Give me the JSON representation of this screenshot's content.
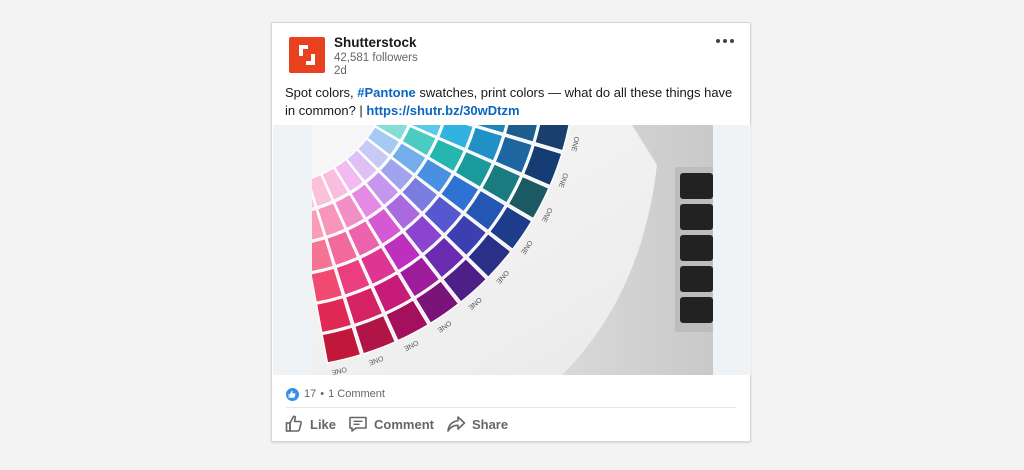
{
  "post": {
    "company_name": "Shutterstock",
    "followers": "42,581 followers",
    "age": "2d",
    "text_before": "Spot colors, ",
    "hashtag": "#Pantone",
    "text_after": " swatches, print colors — what do all these things have in common? | ",
    "link": "https://shutr.bz/30wDtzm",
    "more_icon": "more-horizontal-icon"
  },
  "social": {
    "reactions": "17",
    "separator": "•",
    "comments": "1 Comment",
    "reaction_icon": "thumbs-up-icon"
  },
  "actions": {
    "like": "Like",
    "comment": "Comment",
    "share": "Share"
  },
  "colors": {
    "brand": "#e8411f",
    "link": "#0a66c2",
    "secondary_text": "#666666",
    "like_badge": "#378fe9"
  },
  "image": {
    "alt_semantic": "pantone-swatch-fan-photo",
    "swatch_label": "ONE"
  }
}
